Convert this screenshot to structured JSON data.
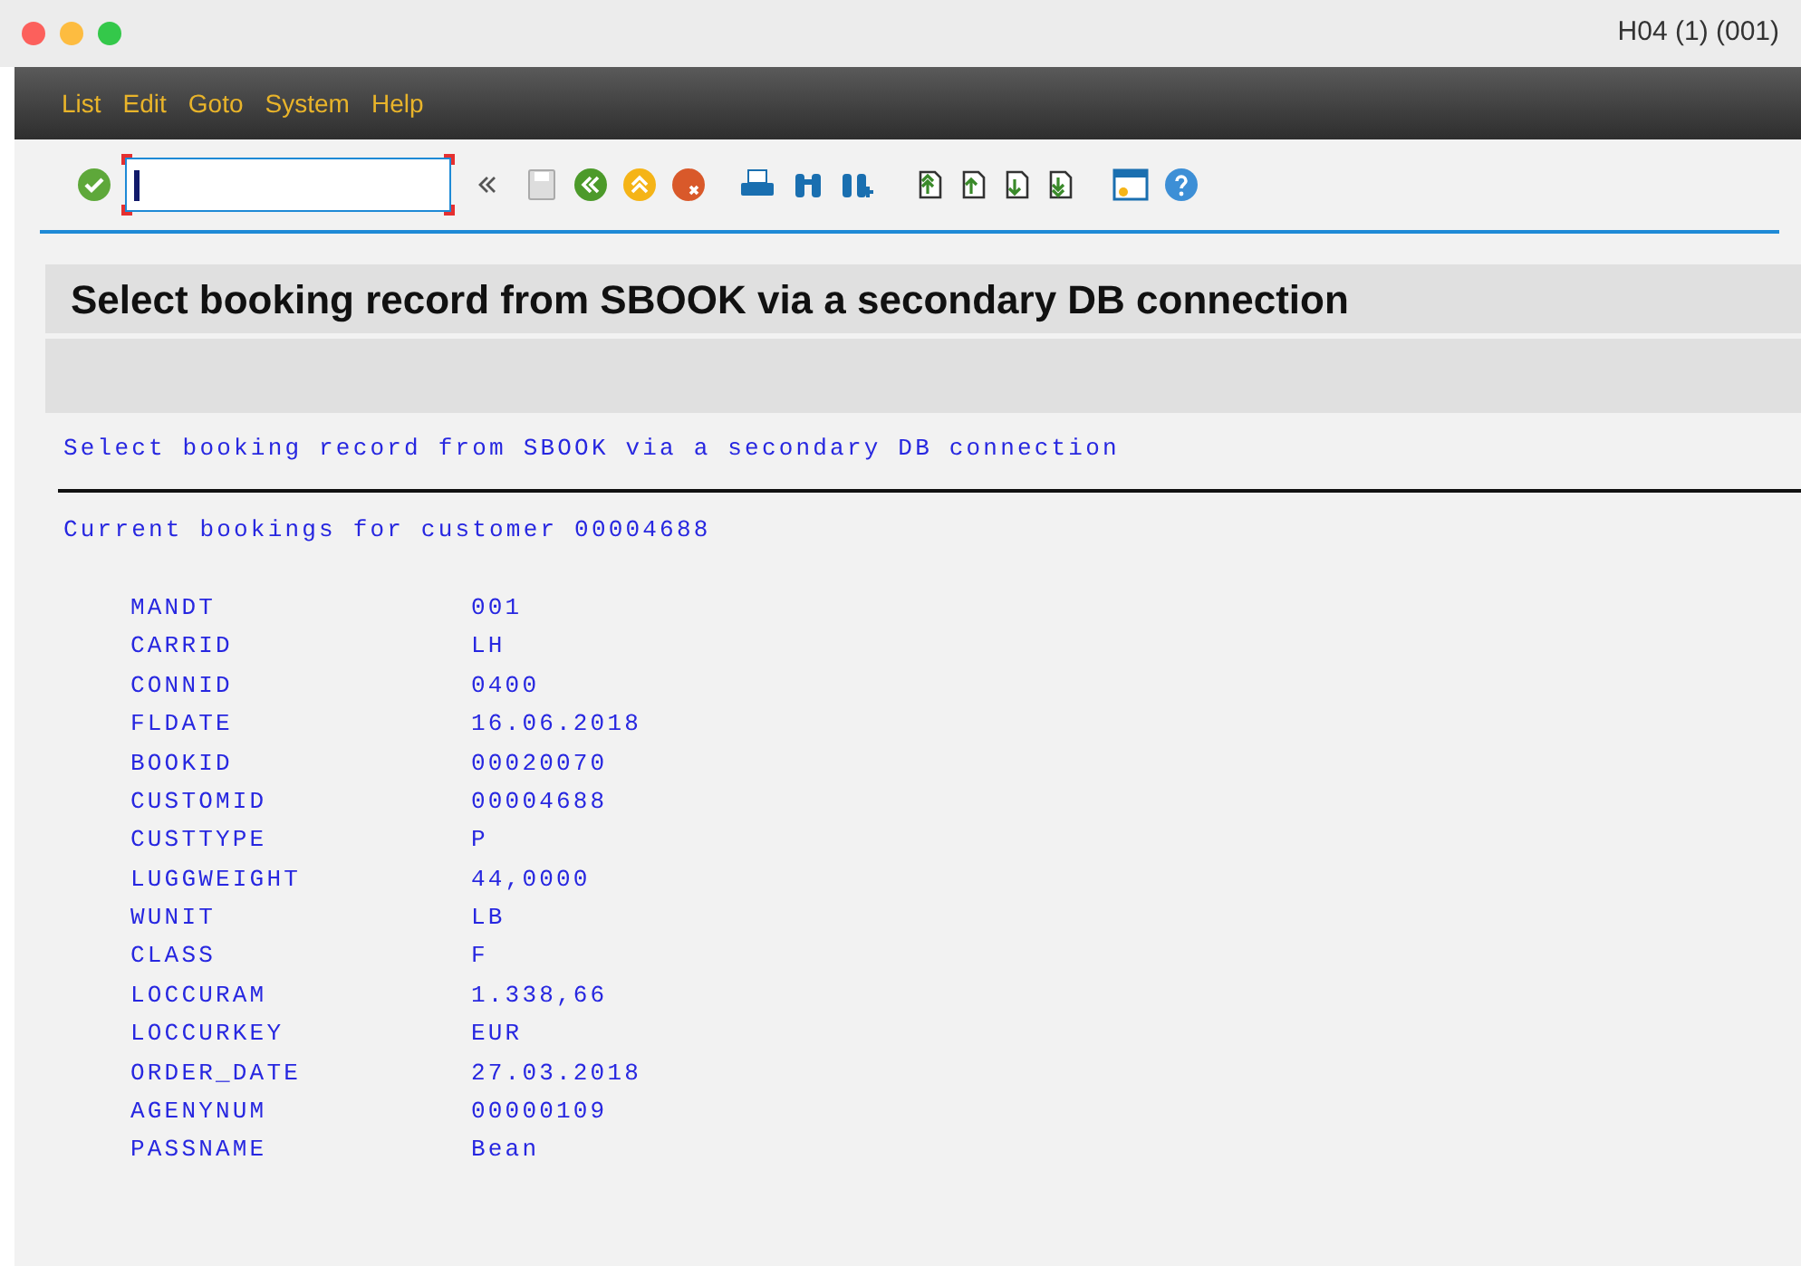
{
  "window": {
    "title": "H04 (1) (001)"
  },
  "menu": [
    "List",
    "Edit",
    "Goto",
    "System",
    "Help"
  ],
  "header": {
    "title": "Select booking record from SBOOK via a secondary DB connection"
  },
  "list": {
    "heading": "Select booking record from SBOOK via a secondary DB connection",
    "subheading": "Current bookings for customer 00004688",
    "rows": [
      {
        "field": "MANDT",
        "value": "001"
      },
      {
        "field": "CARRID",
        "value": "LH"
      },
      {
        "field": "CONNID",
        "value": "0400"
      },
      {
        "field": "FLDATE",
        "value": "16.06.2018"
      },
      {
        "field": "BOOKID",
        "value": "00020070"
      },
      {
        "field": "CUSTOMID",
        "value": "00004688"
      },
      {
        "field": "CUSTTYPE",
        "value": "P"
      },
      {
        "field": "LUGGWEIGHT",
        "value": "44,0000"
      },
      {
        "field": "WUNIT",
        "value": "LB"
      },
      {
        "field": "CLASS",
        "value": "F"
      },
      {
        "field": "LOCCURAM",
        "value": "1.338,66"
      },
      {
        "field": "LOCCURKEY",
        "value": "EUR"
      },
      {
        "field": "ORDER_DATE",
        "value": "27.03.2018"
      },
      {
        "field": "AGENYNUM",
        "value": "00000109"
      },
      {
        "field": "PASSNAME",
        "value": "Bean"
      }
    ]
  }
}
